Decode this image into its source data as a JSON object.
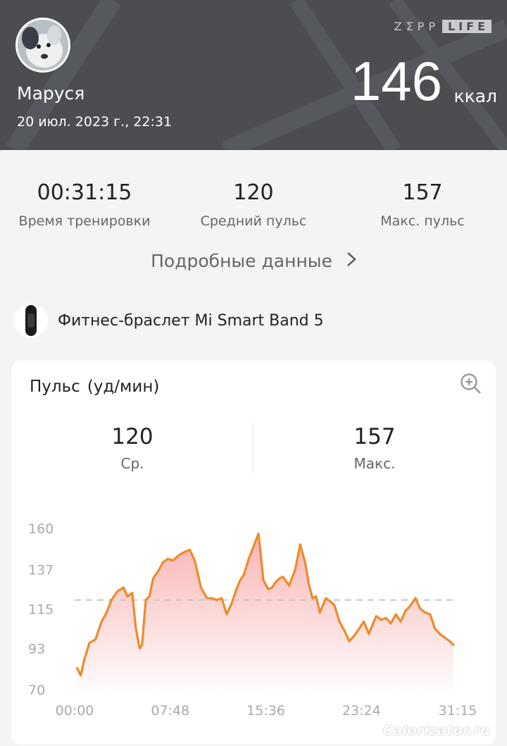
{
  "header": {
    "user_name": "Маруся",
    "date": "20 июл. 2023 г., 22:31",
    "brand_zepp": "ZΣPP",
    "brand_life": "LIFE",
    "calories_value": "146",
    "calories_unit": "ккал",
    "avatar_icon": "dog-avatar"
  },
  "summary": {
    "stats": [
      {
        "value": "00:31:15",
        "label": "Время тренировки"
      },
      {
        "value": "120",
        "label": "Средний пульс"
      },
      {
        "value": "157",
        "label": "Макс. пульс"
      }
    ],
    "details_link": "Подробные данные",
    "details_icon": "chevron-right-icon"
  },
  "device": {
    "name": "Фитнес-браслет Mi Smart Band 5",
    "icon": "band-icon"
  },
  "heart_rate_card": {
    "title": "Пульс",
    "unit": "(уд/мин)",
    "zoom_icon": "zoom-in-icon",
    "avg_value": "120",
    "avg_label": "Ср.",
    "max_value": "157",
    "max_label": "Макс."
  },
  "chart_data": {
    "type": "area",
    "title": "Пульс",
    "ylabel": "(уд/мин)",
    "xlabel": "",
    "y_ticks": [
      "160",
      "137",
      "115",
      "93",
      "70"
    ],
    "x_ticks": [
      "00:00",
      "07:48",
      "15:36",
      "23:24",
      "31:15"
    ],
    "ylim": [
      70,
      160
    ],
    "xlim_minutes": [
      0,
      31.25
    ],
    "average_line": 120,
    "line_color": "#ef8a2a",
    "fill_color": "#f9b0b0",
    "x": [
      0.2,
      0.5,
      0.8,
      1.2,
      1.7,
      2.2,
      2.6,
      3.0,
      3.5,
      4.0,
      4.3,
      4.7,
      5.0,
      5.3,
      5.5,
      5.8,
      6.1,
      6.4,
      6.6,
      6.9,
      7.2,
      7.6,
      8.0,
      8.5,
      9.0,
      9.4,
      9.8,
      10.3,
      10.8,
      11.2,
      11.6,
      12.0,
      12.4,
      12.8,
      13.2,
      13.5,
      13.8,
      14.2,
      14.6,
      15.0,
      15.4,
      15.8,
      16.1,
      16.4,
      16.7,
      17.0,
      17.5,
      18.0,
      18.4,
      18.8,
      19.1,
      19.4,
      19.7,
      20.0,
      20.5,
      20.9,
      21.2,
      21.6,
      22.0,
      22.4,
      22.8,
      23.2,
      23.6,
      24.0,
      24.3,
      24.6,
      25.0,
      25.4,
      25.8,
      26.2,
      26.6,
      27.0,
      27.4,
      27.8,
      28.2,
      28.6,
      29.0,
      29.4,
      29.8,
      30.2,
      30.6,
      30.9
    ],
    "y": [
      82,
      78,
      87,
      96,
      98,
      108,
      113,
      120,
      125,
      127,
      122,
      124,
      104,
      93,
      95,
      120,
      122,
      132,
      134,
      137,
      141,
      143,
      142,
      145,
      147,
      148,
      142,
      127,
      121,
      121,
      120,
      121,
      112,
      118,
      126,
      131,
      134,
      143,
      150,
      157,
      131,
      126,
      127,
      130,
      132,
      133,
      128,
      137,
      151,
      141,
      129,
      121,
      122,
      113,
      121,
      119,
      117,
      108,
      103,
      97,
      100,
      104,
      108,
      101,
      106,
      111,
      109,
      110,
      107,
      112,
      108,
      114,
      117,
      121,
      115,
      113,
      112,
      104,
      101,
      99,
      97,
      95
    ]
  },
  "watermark": "Calorizator.ru"
}
